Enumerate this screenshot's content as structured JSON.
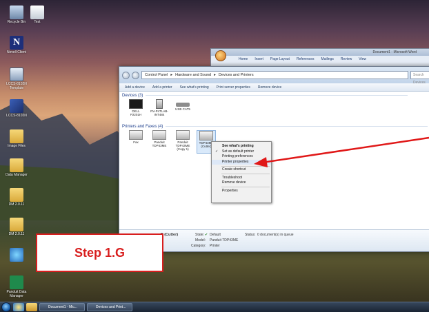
{
  "desktop": {
    "icons": [
      {
        "label": "Recycle Bin",
        "name": "recycle-bin-icon"
      },
      {
        "label": "Test",
        "name": "test-shortcut-icon"
      },
      {
        "label": "Novell Client",
        "name": "novell-client-icon"
      },
      {
        "label": "LCCS-8102N Template",
        "name": "template-shortcut-icon"
      },
      {
        "label": "LCCS-8102N",
        "name": "lccs-app-icon"
      },
      {
        "label": "Image Files",
        "name": "image-files-folder-icon"
      },
      {
        "label": "Data Manager",
        "name": "data-manager-folder-icon"
      },
      {
        "label": "DM 2.0.11",
        "name": "dm-2011-folder-icon"
      },
      {
        "label": "DM 2.0.11",
        "name": "dm-2011-folder-icon-2"
      },
      {
        "label": "",
        "name": "network-app-icon"
      },
      {
        "label": "Panduit Data Manager",
        "name": "panduit-data-manager-icon"
      }
    ]
  },
  "word_window": {
    "title": "Document1 - Microsoft Word",
    "tabs": [
      "Home",
      "Insert",
      "Page Layout",
      "References",
      "Mailings",
      "Review",
      "View"
    ]
  },
  "explorer": {
    "address": [
      "Control Panel",
      "Hardware and Sound",
      "Devices and Printers"
    ],
    "search_placeholder": "Search Devices",
    "toolbar": [
      "Add a device",
      "Add a printer",
      "See what's printing",
      "Print server properties",
      "Remove device"
    ],
    "devices_header": "Devices (3)",
    "devices": [
      {
        "label": "DELL P2201H",
        "icon": "monitor-icon"
      },
      {
        "label": "RV-P4TLAB-INT484",
        "icon": "computer-tower-icon"
      },
      {
        "label": "USB CAT5",
        "icon": "keyboard-icon"
      }
    ],
    "printers_header": "Printers and Faxes (4)",
    "printers": [
      {
        "label": "Fax",
        "icon": "fax-icon"
      },
      {
        "label": "Panduit TDP43ME",
        "icon": "printer-icon"
      },
      {
        "label": "Panduit TDP43ME (Copy 1)",
        "icon": "printer-icon"
      },
      {
        "label": "TDP43ME (Cutter)",
        "icon": "printer-icon"
      }
    ],
    "details": {
      "name": "E (Cutter)",
      "state_label": "State:",
      "state_value": "Default",
      "model_label": "Model:",
      "model_value": "Panduit TDP43ME",
      "category_label": "Category:",
      "category_value": "Printer",
      "status_label": "Status:",
      "status_value": "0 document(s) in queue"
    }
  },
  "context_menu": {
    "items": [
      {
        "label": "See what's printing",
        "bold": true
      },
      {
        "label": "Set as default printer",
        "checked": true
      },
      {
        "label": "Printing preferences"
      },
      {
        "label": "Printer properties",
        "highlighted": true
      },
      {
        "separator": true
      },
      {
        "label": "Create shortcut"
      },
      {
        "separator": true
      },
      {
        "label": "Troubleshoot"
      },
      {
        "label": "Remove device"
      },
      {
        "separator": true
      },
      {
        "label": "Properties"
      }
    ]
  },
  "callout": {
    "label": "Step 1.G",
    "color": "#d81e1e"
  },
  "taskbar": {
    "tasks": [
      "Document1 - Mic...",
      "Devices and Print..."
    ]
  }
}
